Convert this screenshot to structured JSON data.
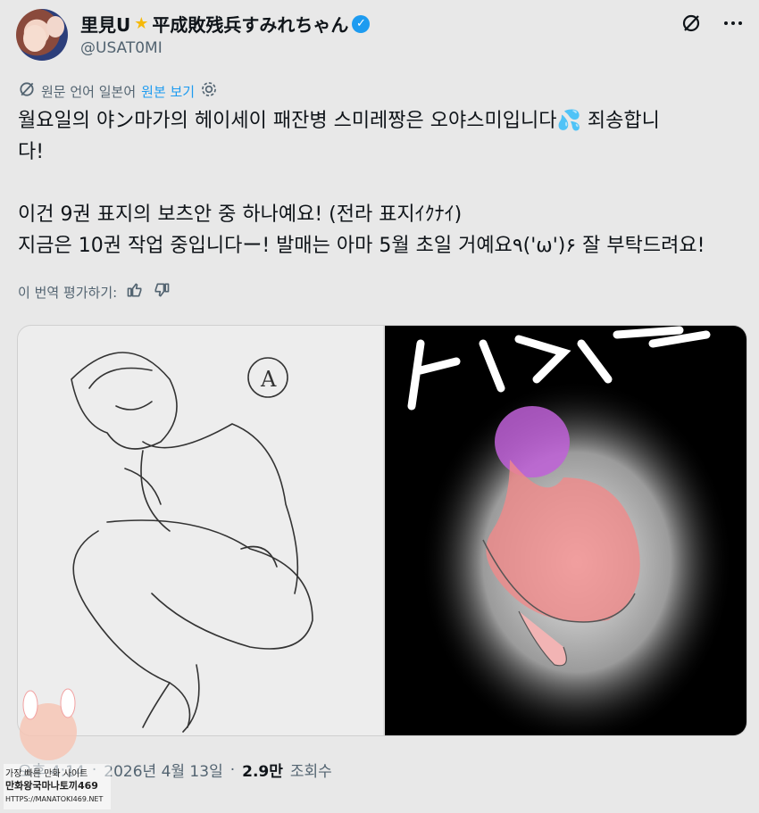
{
  "header": {
    "display_name": "里見U",
    "display_name_suffix": "平成敗残兵すみれちゃん",
    "handle": "@USAT0MI"
  },
  "translation": {
    "source_label": "원문 언어 일본어",
    "show_original": "원본 보기"
  },
  "tweet": {
    "line1": "월요일의 야ン마가의 헤이세이 패잔병 스미레짱은 오야스미입니다",
    "line1_end": "죄송합니",
    "line2": "다!",
    "line3": "이건 9권 표지의 보츠안 중 하나예요! (전라 표지ｲｸﾅｲ)",
    "line4": "지금은 10권 작업 중입니다ー! 발매는 아마 5월 초일 거예요٩('ω')۶ 잘 부탁드려요!"
  },
  "rate": {
    "label": "이 번역 평가하기:"
  },
  "media": {
    "left_label": "A",
    "right_text": "ドォ ル"
  },
  "meta": {
    "time": "오후 4:14",
    "date": "2026년 4월 13일",
    "views": "2.9만",
    "views_label": "조회수"
  },
  "watermark": {
    "line1": "가장 빠른 만화 사이트",
    "line2": "만화왕국마나토끼469",
    "line3": "HTTPS://MANATOKI469.NET"
  },
  "colors": {
    "accent": "#1d9bf0",
    "muted": "#536471",
    "text": "#0f1419"
  }
}
